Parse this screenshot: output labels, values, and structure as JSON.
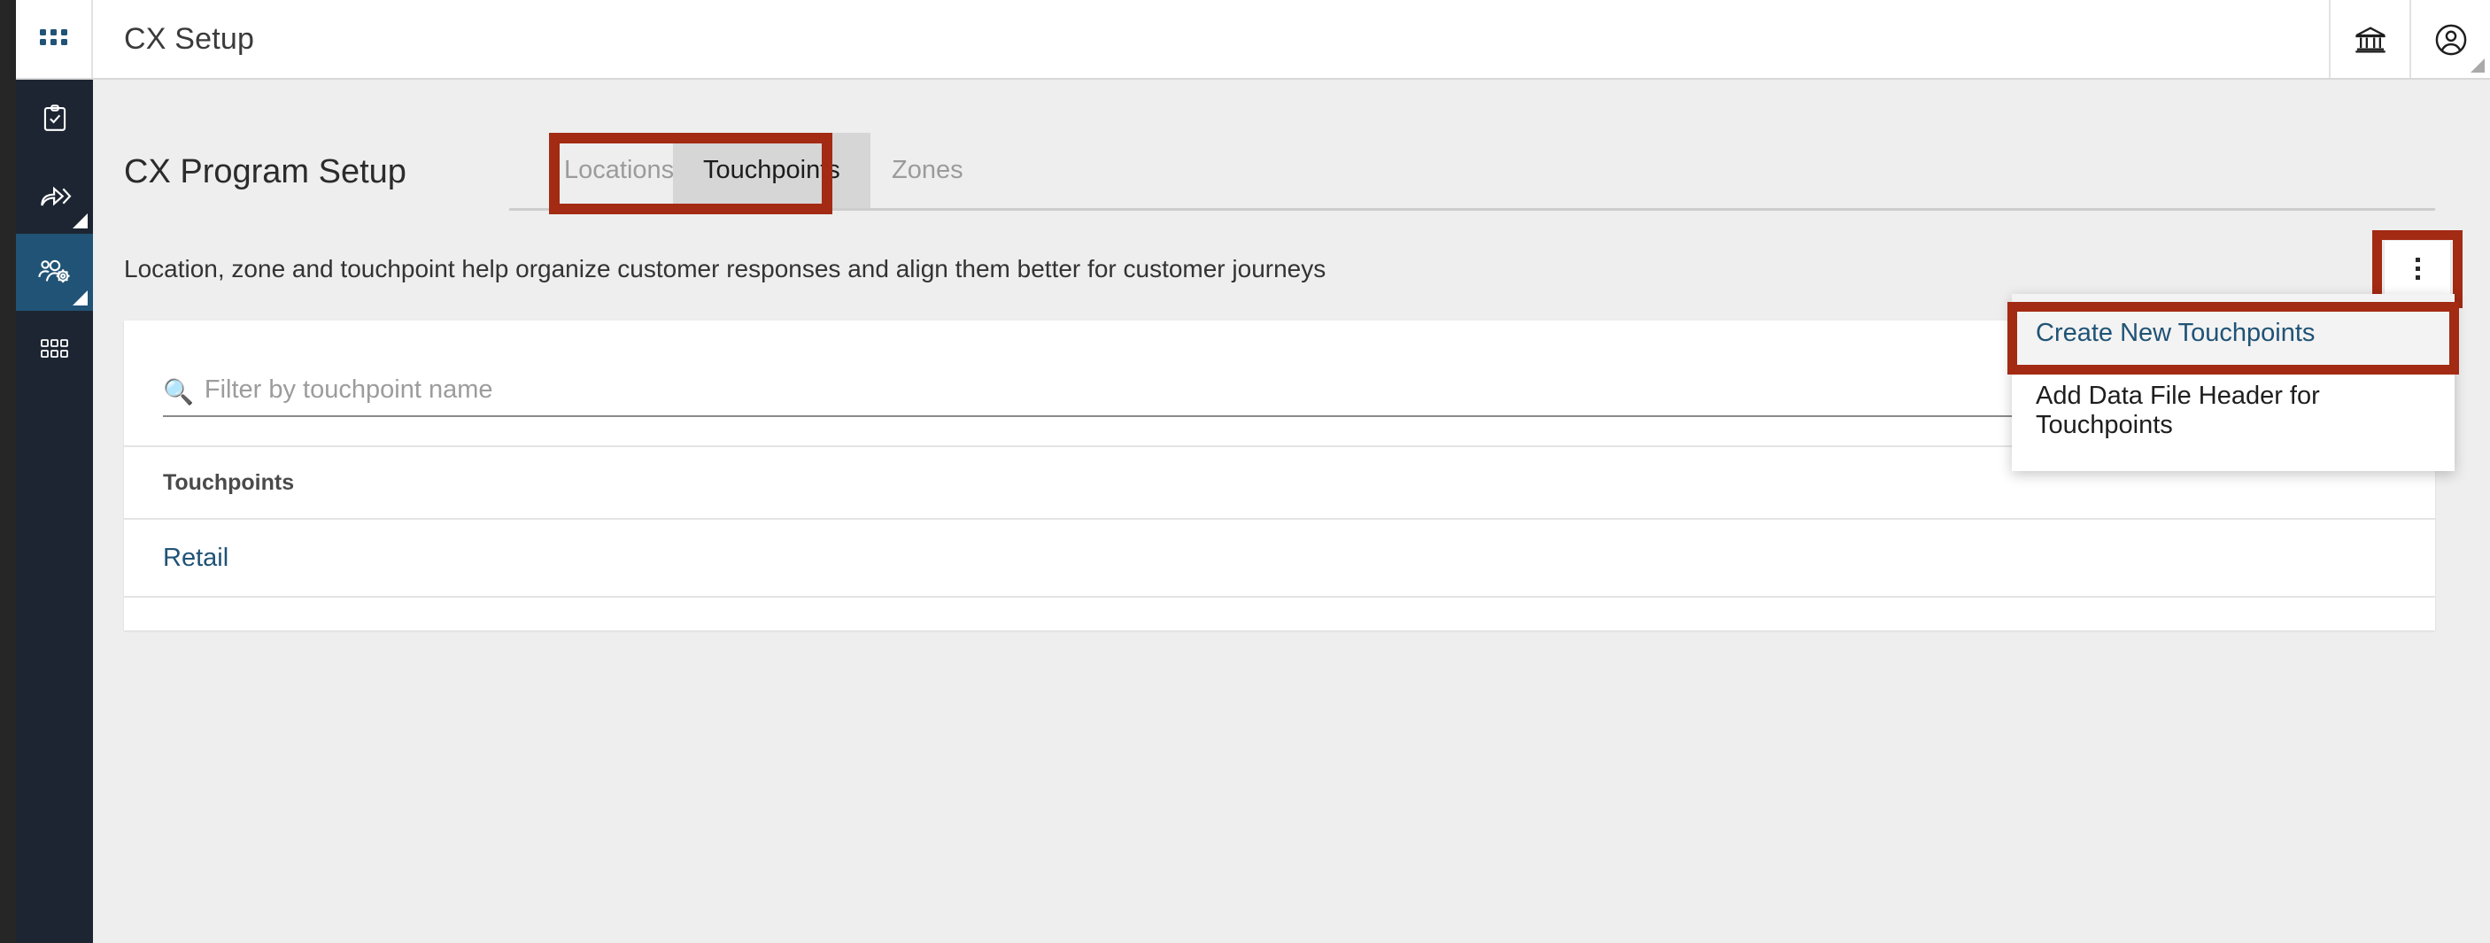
{
  "topbar": {
    "grid_icon": "apps-grid-icon",
    "app_title": "CX Setup",
    "institution_icon": "bank-institution-icon",
    "account_icon": "user-account-icon"
  },
  "sidebar": {
    "items": [
      {
        "icon": "clipboard-check-icon",
        "active": false,
        "has_corner": false
      },
      {
        "icon": "share-arrow-icon",
        "active": false,
        "has_corner": true
      },
      {
        "icon": "people-settings-icon",
        "active": true,
        "has_corner": true
      },
      {
        "icon": "grid-squares-icon",
        "active": false,
        "has_corner": false
      }
    ]
  },
  "page": {
    "title": "CX Program Setup",
    "description": "Location, zone and touchpoint help organize customer responses and align them better for customer journeys"
  },
  "tabs": [
    {
      "label": "Locations",
      "active": false
    },
    {
      "label": "Touchpoints",
      "active": true
    },
    {
      "label": "Zones",
      "active": false
    }
  ],
  "filter": {
    "search_icon": "magnifier-icon",
    "placeholder": "Filter by touchpoint name",
    "value": ""
  },
  "table": {
    "columns": [
      "Touchpoints"
    ],
    "rows": [
      {
        "name": "Retail"
      }
    ]
  },
  "kebab": {
    "icon": "vertical-ellipsis-icon",
    "menu": [
      {
        "label": "Create New Touchpoints",
        "hovered": true
      },
      {
        "label": "Add Data File Header for Touchpoints",
        "hovered": false
      }
    ]
  },
  "annotations": {
    "color": "#a32a13",
    "targets": [
      "tab-touchpoints",
      "kebab-button",
      "menu-item-create-new-touchpoints"
    ]
  },
  "colors": {
    "accent": "#205376",
    "sidebar_bg": "#1d2532",
    "gutter": "#262626",
    "page_bg": "#eeeeee",
    "card_bg": "#ffffff",
    "annotation_red": "#a32a13",
    "tab_active_bg": "#d6d6d6"
  }
}
